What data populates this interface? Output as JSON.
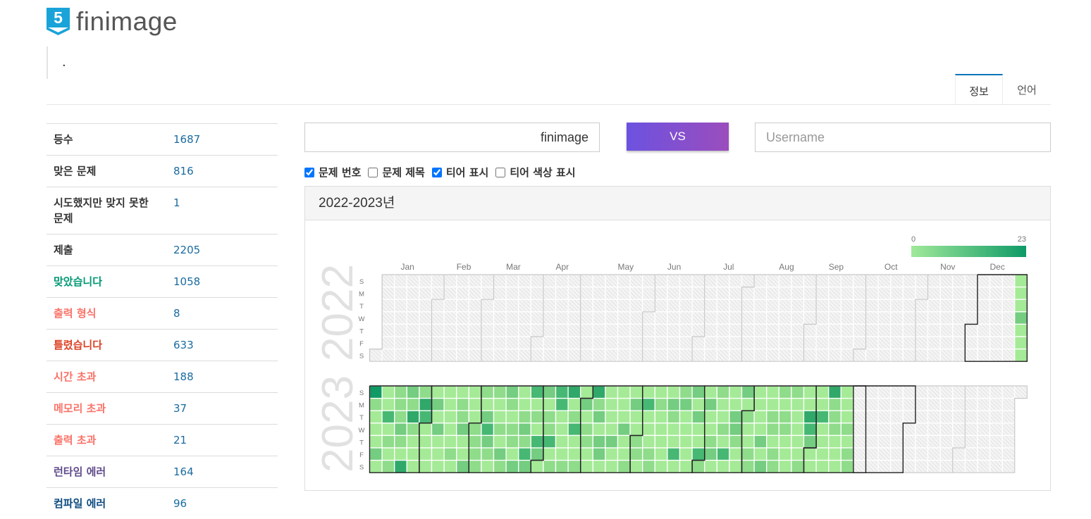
{
  "brand": {
    "badge_number": "5",
    "name": "finimage",
    "badge_color": "#1aa3d9"
  },
  "status_message": ".",
  "tabs": [
    {
      "label": "정보",
      "active": true
    },
    {
      "label": "언어",
      "active": false
    }
  ],
  "stats": [
    {
      "label": "등수",
      "value": "1687",
      "label_color": "#333333"
    },
    {
      "label": "맞은 문제",
      "value": "816",
      "label_color": "#333333"
    },
    {
      "label": "시도했지만 맞지 못한 문제",
      "value": "1",
      "label_color": "#333333"
    },
    {
      "label": "제출",
      "value": "2205",
      "label_color": "#333333"
    },
    {
      "label": "맞았습니다",
      "value": "1058",
      "label_color": "#009874"
    },
    {
      "label": "출력 형식",
      "value": "8",
      "label_color": "#fa7268"
    },
    {
      "label": "틀렸습니다",
      "value": "633",
      "label_color": "#dd4124"
    },
    {
      "label": "시간 초과",
      "value": "188",
      "label_color": "#fa7268"
    },
    {
      "label": "메모리 초과",
      "value": "37",
      "label_color": "#fa7268"
    },
    {
      "label": "출력 초과",
      "value": "21",
      "label_color": "#fa7268"
    },
    {
      "label": "런타임 에러",
      "value": "164",
      "label_color": "#5f4b8b"
    },
    {
      "label": "컴파일 에러",
      "value": "96",
      "label_color": "#0f4c81"
    }
  ],
  "compare": {
    "user_value": "finimage",
    "vs_label": "VS",
    "other_placeholder": "Username"
  },
  "options": [
    {
      "label": "문제 번호",
      "checked": true
    },
    {
      "label": "문제 제목",
      "checked": false
    },
    {
      "label": "티어 표시",
      "checked": true
    },
    {
      "label": "티어 색상 표시",
      "checked": false
    }
  ],
  "heatmap": {
    "title": "2022-2023년",
    "legend_min": "0",
    "legend_max": "23",
    "legend_colors": [
      "#a0e99a",
      "#0f9a67"
    ],
    "months": [
      "Jan",
      "Feb",
      "Mar",
      "Apr",
      "May",
      "Jun",
      "Jul",
      "Aug",
      "Sep",
      "Oct",
      "Nov",
      "Dec"
    ],
    "weekdays": [
      "S",
      "M",
      "T",
      "W",
      "T",
      "F",
      "S"
    ],
    "years": [
      "2022",
      "2023"
    ]
  }
}
